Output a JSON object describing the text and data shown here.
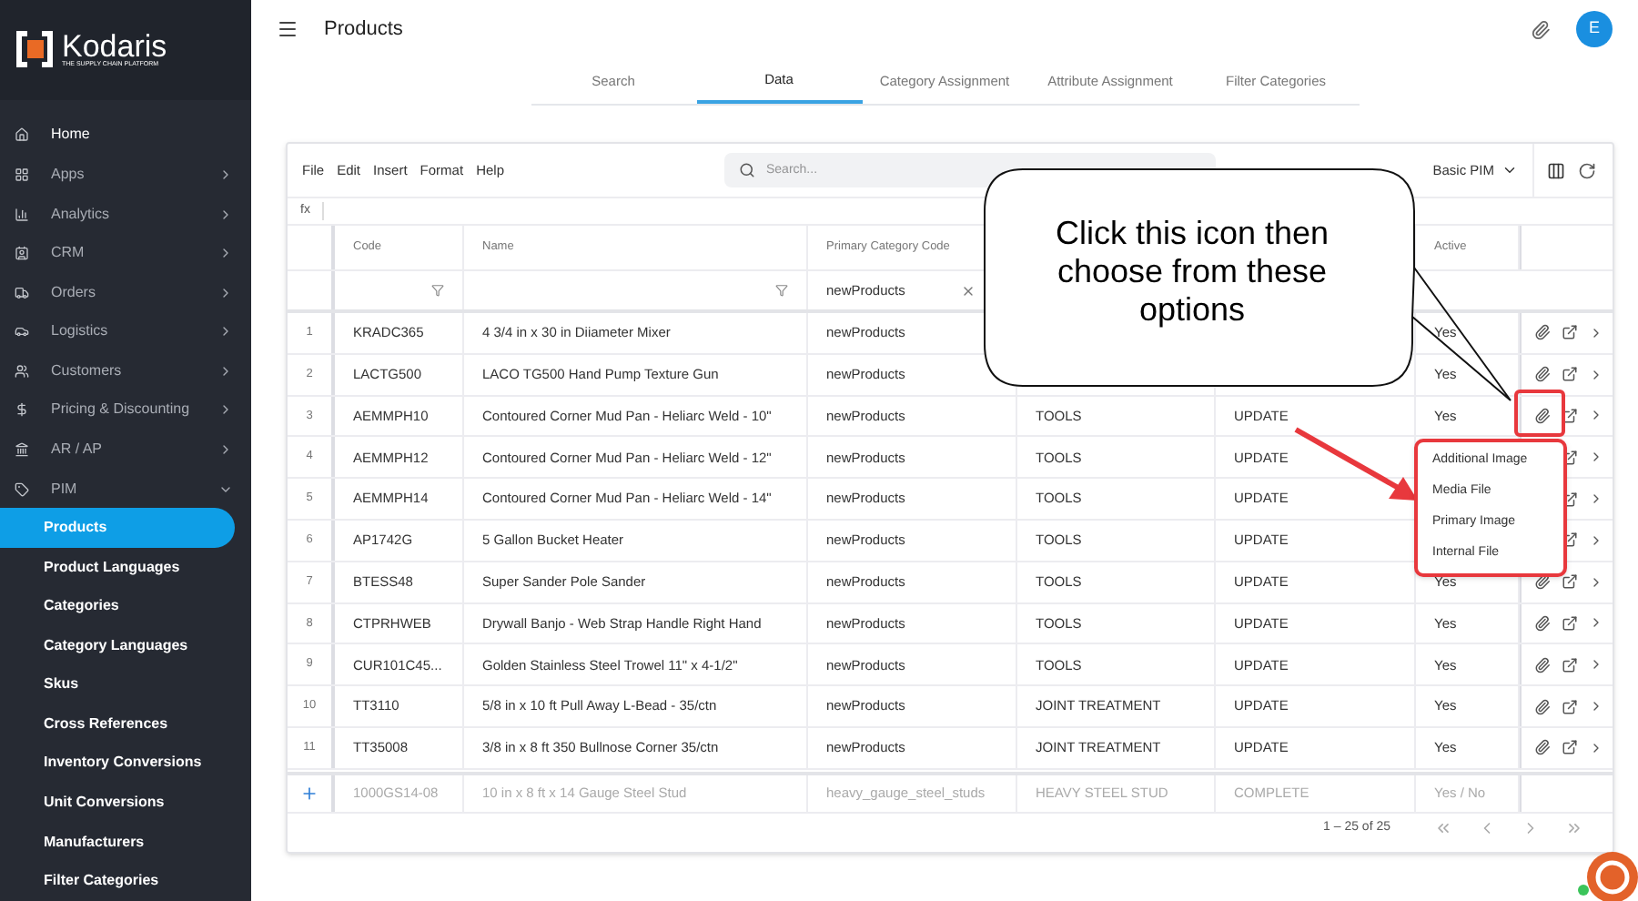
{
  "brand": {
    "name": "Kodaris",
    "tagline": "THE SUPPLY CHAIN PLATFORM"
  },
  "sidebar": {
    "items": [
      {
        "label": "Home"
      },
      {
        "label": "Apps",
        "expanded": false
      },
      {
        "label": "Analytics",
        "expanded": false
      },
      {
        "label": "CRM",
        "expanded": false
      },
      {
        "label": "Orders",
        "expanded": false
      },
      {
        "label": "Logistics",
        "expanded": false
      },
      {
        "label": "Customers",
        "expanded": false
      },
      {
        "label": "Pricing & Discounting",
        "expanded": false
      },
      {
        "label": "AR / AP",
        "expanded": false
      },
      {
        "label": "PIM",
        "expanded": true,
        "children": [
          {
            "label": "Products",
            "selected": true
          },
          {
            "label": "Product Languages",
            "selected": false
          },
          {
            "label": "Categories",
            "selected": false
          },
          {
            "label": "Category Languages",
            "selected": false
          },
          {
            "label": "Skus",
            "selected": false
          },
          {
            "label": "Cross References",
            "selected": false
          },
          {
            "label": "Inventory Conversions",
            "selected": false
          },
          {
            "label": "Unit Conversions",
            "selected": false
          },
          {
            "label": "Manufacturers",
            "selected": false
          },
          {
            "label": "Filter Categories",
            "selected": false
          }
        ]
      }
    ]
  },
  "header": {
    "title": "Products",
    "avatar": "E"
  },
  "tabs": [
    {
      "label": "Search",
      "selected": false
    },
    {
      "label": "Data",
      "selected": true
    },
    {
      "label": "Category Assignment",
      "selected": false
    },
    {
      "label": "Attribute Assignment",
      "selected": false
    },
    {
      "label": "Filter Categories",
      "selected": false
    }
  ],
  "toolbar": {
    "menu": [
      "File",
      "Edit",
      "Insert",
      "Format",
      "Help"
    ],
    "search": {
      "placeholder": "Search..."
    },
    "view": "Basic PIM"
  },
  "formula_bar": {
    "label": "fx"
  },
  "table": {
    "columns": [
      "Code",
      "Name",
      "Primary Category Code",
      null,
      null,
      "Active"
    ],
    "filters": {
      "column_3": "newProducts"
    },
    "rows": [
      {
        "num": "1",
        "code": "KRADC365",
        "name": "4 3/4 in x 30 in Diiameter Mixer",
        "category": "newProducts",
        "active": "Yes"
      },
      {
        "num": "2",
        "code": "LACTG500",
        "name": "LACO TG500 Hand Pump Texture Gun",
        "category": "newProducts",
        "active": "Yes"
      },
      {
        "num": "3",
        "code": "AEMMPH10",
        "name": "Contoured Corner Mud Pan - Heliarc Weld - 10\"",
        "category": "newProducts",
        "column_4": "TOOLS",
        "column_5": "UPDATE",
        "active": "Yes"
      },
      {
        "num": "4",
        "code": "AEMMPH12",
        "name": "Contoured Corner Mud Pan - Heliarc Weld - 12\"",
        "category": "newProducts",
        "column_4": "TOOLS",
        "column_5": "UPDATE"
      },
      {
        "num": "5",
        "code": "AEMMPH14",
        "name": "Contoured Corner Mud Pan - Heliarc Weld - 14\"",
        "category": "newProducts",
        "column_4": "TOOLS",
        "column_5": "UPDATE"
      },
      {
        "num": "6",
        "code": "AP1742G",
        "name": "5 Gallon Bucket Heater",
        "category": "newProducts",
        "column_4": "TOOLS",
        "column_5": "UPDATE"
      },
      {
        "num": "7",
        "code": "BTESS48",
        "name": "Super Sander Pole Sander",
        "category": "newProducts",
        "column_4": "TOOLS",
        "column_5": "UPDATE",
        "active": "Yes"
      },
      {
        "num": "8",
        "code": "CTPRHWEB",
        "name": "Drywall Banjo - Web Strap Handle Right Hand",
        "category": "newProducts",
        "column_4": "TOOLS",
        "column_5": "UPDATE",
        "active": "Yes"
      },
      {
        "num": "9",
        "code": "CUR101C45...",
        "name": "Golden Stainless Steel Trowel 11\" x 4-1/2\"",
        "category": "newProducts",
        "column_4": "TOOLS",
        "column_5": "UPDATE",
        "active": "Yes"
      },
      {
        "num": "10",
        "code": "TT3110",
        "name": "5/8 in x 10 ft Pull Away L-Bead - 35/ctn",
        "category": "newProducts",
        "column_4": "JOINT TREATMENT",
        "column_5": "UPDATE",
        "active": "Yes"
      },
      {
        "num": "11",
        "code": "TT35008",
        "name": "3/8 in x 8 ft 350 Bullnose Corner 35/ctn",
        "category": "newProducts",
        "column_4": "JOINT TREATMENT",
        "column_5": "UPDATE",
        "active": "Yes"
      }
    ],
    "new_row": {
      "code": "1000GS14-08",
      "name": "10 in x 8 ft x 14 Gauge Steel Stud",
      "category": "heavy_gauge_steel_studs",
      "column_4": "HEAVY STEEL STUD",
      "column_5": "COMPLETE",
      "active": "Yes / No"
    }
  },
  "pagination": {
    "range": "1 – 25 of 25"
  },
  "attach_menu": {
    "items": [
      "Additional Image",
      "Media File",
      "Primary Image",
      "Internal File"
    ]
  },
  "callout": {
    "text": "Click this icon then choose from these options"
  }
}
